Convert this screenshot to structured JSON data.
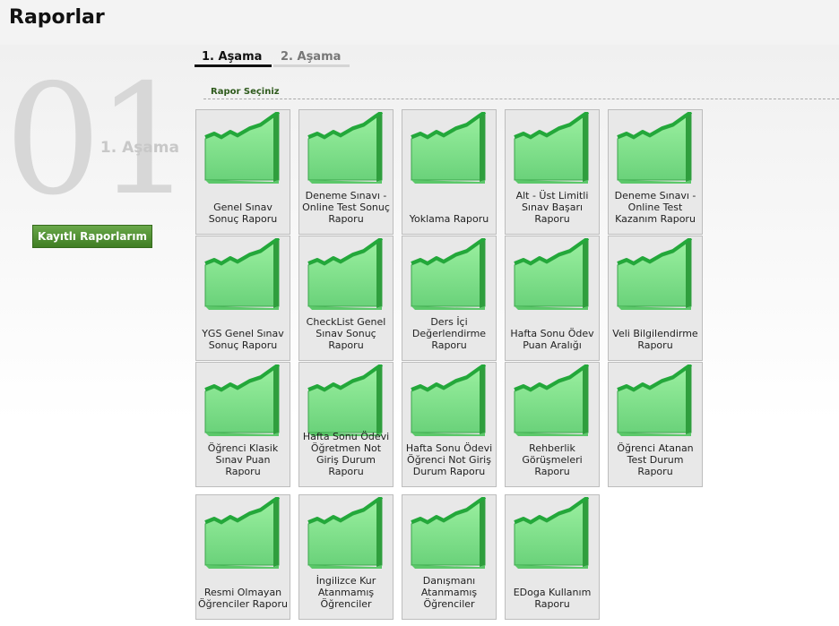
{
  "page": {
    "title": "Raporlar"
  },
  "step": {
    "number": "01",
    "label": "1. Aşama"
  },
  "buttons": {
    "saved_reports": "Kayıtlı Raporlarım"
  },
  "tabs": [
    {
      "label": "1. Aşama",
      "active": true
    },
    {
      "label": "2. Aşama",
      "active": false
    }
  ],
  "section": {
    "label": "Rapor Seçiniz"
  },
  "icon": {
    "name": "chart-icon",
    "color": "#3bbf4a"
  },
  "reports": [
    {
      "label": "Genel Sınav Sonuç Raporu"
    },
    {
      "label": "Deneme Sınavı - Online Test Sonuç Raporu"
    },
    {
      "label": "Yoklama Raporu"
    },
    {
      "label": "Alt - Üst Limitli Sınav Başarı Raporu"
    },
    {
      "label": "Deneme Sınavı - Online Test Kazanım Raporu"
    },
    {
      "label": "YGS Genel Sınav Sonuç Raporu"
    },
    {
      "label": "CheckList Genel Sınav Sonuç Raporu"
    },
    {
      "label": "Ders İçi Değerlendirme Raporu"
    },
    {
      "label": "Hafta Sonu Ödev Puan Aralığı"
    },
    {
      "label": "Veli Bilgilendirme Raporu"
    },
    {
      "label": "Öğrenci Klasik Sınav Puan Raporu"
    },
    {
      "label": "Hafta Sonu Ödevi Öğretmen Not Giriş Durum Raporu"
    },
    {
      "label": "Hafta Sonu Ödevi Öğrenci Not Giriş Durum Raporu"
    },
    {
      "label": "Rehberlik Görüşmeleri Raporu"
    },
    {
      "label": "Öğrenci Atanan Test Durum Raporu"
    },
    {
      "label": "Resmi Olmayan Öğrenciler Raporu"
    },
    {
      "label": "İngilizce Kur Atanmamış Öğrenciler"
    },
    {
      "label": "Danışmanı Atanmamış Öğrenciler"
    },
    {
      "label": "EDoga Kullanım Raporu"
    }
  ]
}
